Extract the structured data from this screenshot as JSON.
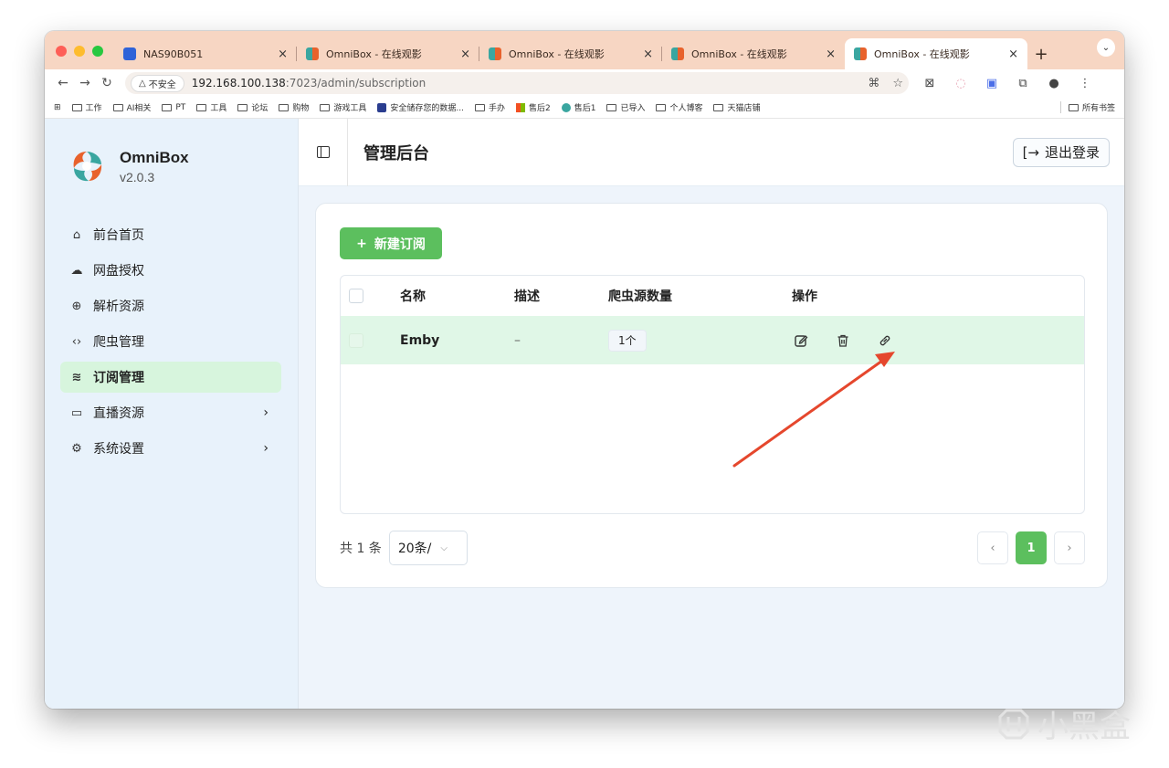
{
  "tabs": [
    {
      "title": "NAS90B051",
      "favicon": "nas-icon",
      "active": false
    },
    {
      "title": "OmniBox - 在线观影",
      "favicon": "omnibox-icon",
      "active": false
    },
    {
      "title": "OmniBox - 在线观影",
      "favicon": "omnibox-icon",
      "active": false
    },
    {
      "title": "OmniBox - 在线观影",
      "favicon": "omnibox-icon",
      "active": false
    },
    {
      "title": "OmniBox - 在线观影",
      "favicon": "omnibox-icon",
      "active": true
    }
  ],
  "tab_close": "×",
  "new_tab": "+",
  "address": {
    "security_label": "不安全",
    "host": "192.168.100.138",
    "path": ":7023/admin/subscription"
  },
  "bookmarks": [
    {
      "label": "工作"
    },
    {
      "label": "AI相关"
    },
    {
      "label": "PT"
    },
    {
      "label": "工具"
    },
    {
      "label": "论坛"
    },
    {
      "label": "购物"
    },
    {
      "label": "游戏工具"
    },
    {
      "label": "安全储存您的数据..."
    },
    {
      "label": "手办"
    },
    {
      "label": "售后2"
    },
    {
      "label": "售后1"
    },
    {
      "label": "已导入"
    },
    {
      "label": "个人博客"
    },
    {
      "label": "天猫店铺"
    }
  ],
  "bookmarks_all": "所有书签",
  "app": {
    "name": "OmniBox",
    "version": "v2.0.3"
  },
  "sidebar": {
    "items": [
      {
        "label": "前台首页",
        "icon": "home-icon",
        "active": false,
        "has_arrow": false
      },
      {
        "label": "网盘授权",
        "icon": "cloud-icon",
        "active": false,
        "has_arrow": false
      },
      {
        "label": "解析资源",
        "icon": "globe-icon",
        "active": false,
        "has_arrow": false
      },
      {
        "label": "爬虫管理",
        "icon": "code-icon",
        "active": false,
        "has_arrow": false
      },
      {
        "label": "订阅管理",
        "icon": "rss-icon",
        "active": true,
        "has_arrow": false
      },
      {
        "label": "直播资源",
        "icon": "tv-icon",
        "active": false,
        "has_arrow": true
      },
      {
        "label": "系统设置",
        "icon": "gear-icon",
        "active": false,
        "has_arrow": true
      }
    ]
  },
  "header": {
    "title": "管理后台",
    "logout_label": "退出登录"
  },
  "table": {
    "add_label": "新建订阅",
    "columns": [
      "名称",
      "描述",
      "爬虫源数量",
      "操作"
    ],
    "rows": [
      {
        "name": "Emby",
        "description": "–",
        "count": "1个"
      }
    ],
    "total": "共 1 条",
    "page_size": "20条/",
    "current_page": "1"
  },
  "colors": {
    "accent": "#5cbf5e",
    "row_highlight": "#e0f7e7",
    "sidebar_bg": "#e8f2fb",
    "annotation_arrow": "#e5472d"
  },
  "watermark": "小黑盒"
}
